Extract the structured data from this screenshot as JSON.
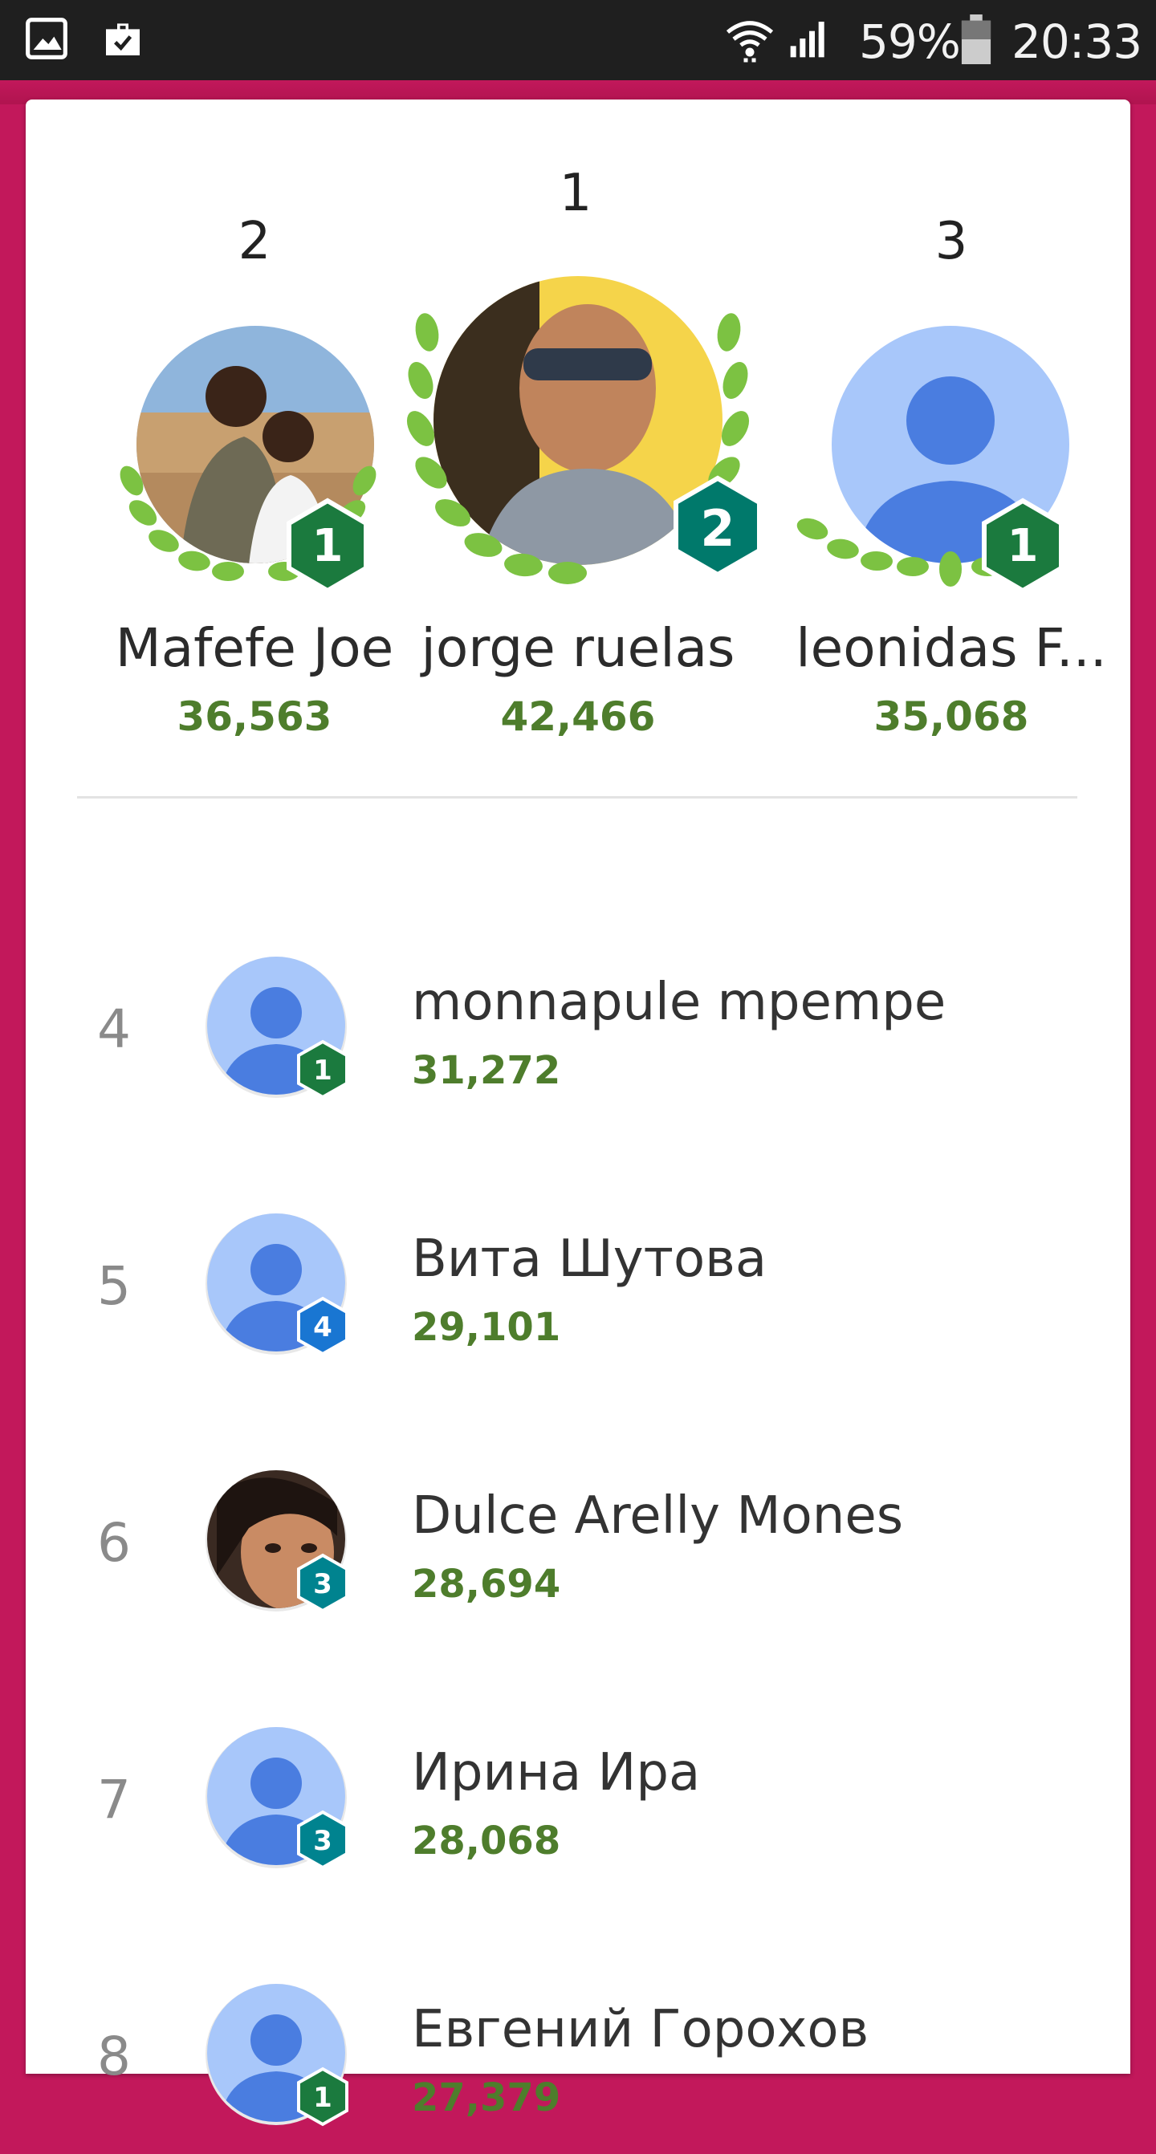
{
  "status_bar": {
    "icons": [
      "gallery-icon",
      "briefcase-icon",
      "wifi-icon",
      "signal-icon",
      "battery-icon"
    ],
    "battery": "59%",
    "time": "20:33"
  },
  "colors": {
    "frame": "#c2185b",
    "score": "#4e7d2c",
    "badge_green": "#1b7a3e",
    "badge_teal": "#00796b",
    "badge_blue": "#1976d2",
    "badge_cyan": "#00838f",
    "avatar_bg": "#a8c7fa",
    "avatar_fg": "#4a7de0"
  },
  "podium": [
    {
      "rank": "2",
      "name": "Mafefe Joe",
      "score": "36,563",
      "badge": "1",
      "avatar": "photo"
    },
    {
      "rank": "1",
      "name": "jorge ruelas",
      "score": "42,466",
      "badge": "2",
      "avatar": "photo"
    },
    {
      "rank": "3",
      "name": "leonidas F...",
      "score": "35,068",
      "badge": "1",
      "avatar": "default"
    }
  ],
  "leaderboard": [
    {
      "rank": "4",
      "name": "monnapule mpempe",
      "score": "31,272",
      "badge": "1",
      "avatar": "default"
    },
    {
      "rank": "5",
      "name": "Вита Шутова",
      "score": "29,101",
      "badge": "4",
      "avatar": "default"
    },
    {
      "rank": "6",
      "name": "Dulce Arelly Mones",
      "score": "28,694",
      "badge": "3",
      "avatar": "photo"
    },
    {
      "rank": "7",
      "name": "Ирина Ира",
      "score": "28,068",
      "badge": "3",
      "avatar": "default"
    },
    {
      "rank": "8",
      "name": "Евгений Горохов",
      "score": "27,379",
      "badge": "1",
      "avatar": "default"
    }
  ]
}
